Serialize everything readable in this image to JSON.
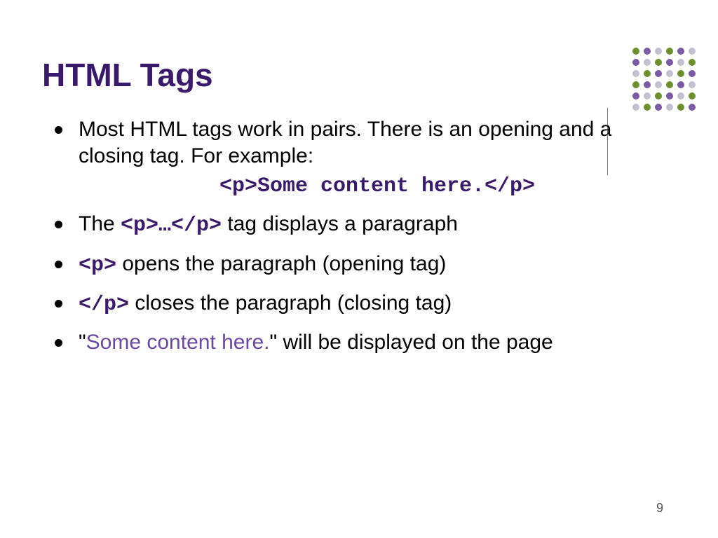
{
  "title": "HTML Tags",
  "bullets": {
    "b1": "Most HTML tags work in pairs.  There is an opening and a closing tag.  For example:",
    "codeExample": "<p>Some content here.</p>",
    "b2_pre": "The ",
    "b2_code": "<p>…</p>",
    "b2_post": " tag displays a paragraph",
    "b3_code": "<p>",
    "b3_post": " opens the paragraph (opening tag)",
    "b4_code": "</p>",
    "b4_post": " closes the paragraph (closing tag)",
    "b5_pre": "\"",
    "b5_accent": "Some content here.",
    "b5_post": "\" will be displayed on the page"
  },
  "pageNumber": "9",
  "decorColors": {
    "c1": "#6f8f2f",
    "c2": "#7a5aa0",
    "c3": "#c0c0d0"
  }
}
